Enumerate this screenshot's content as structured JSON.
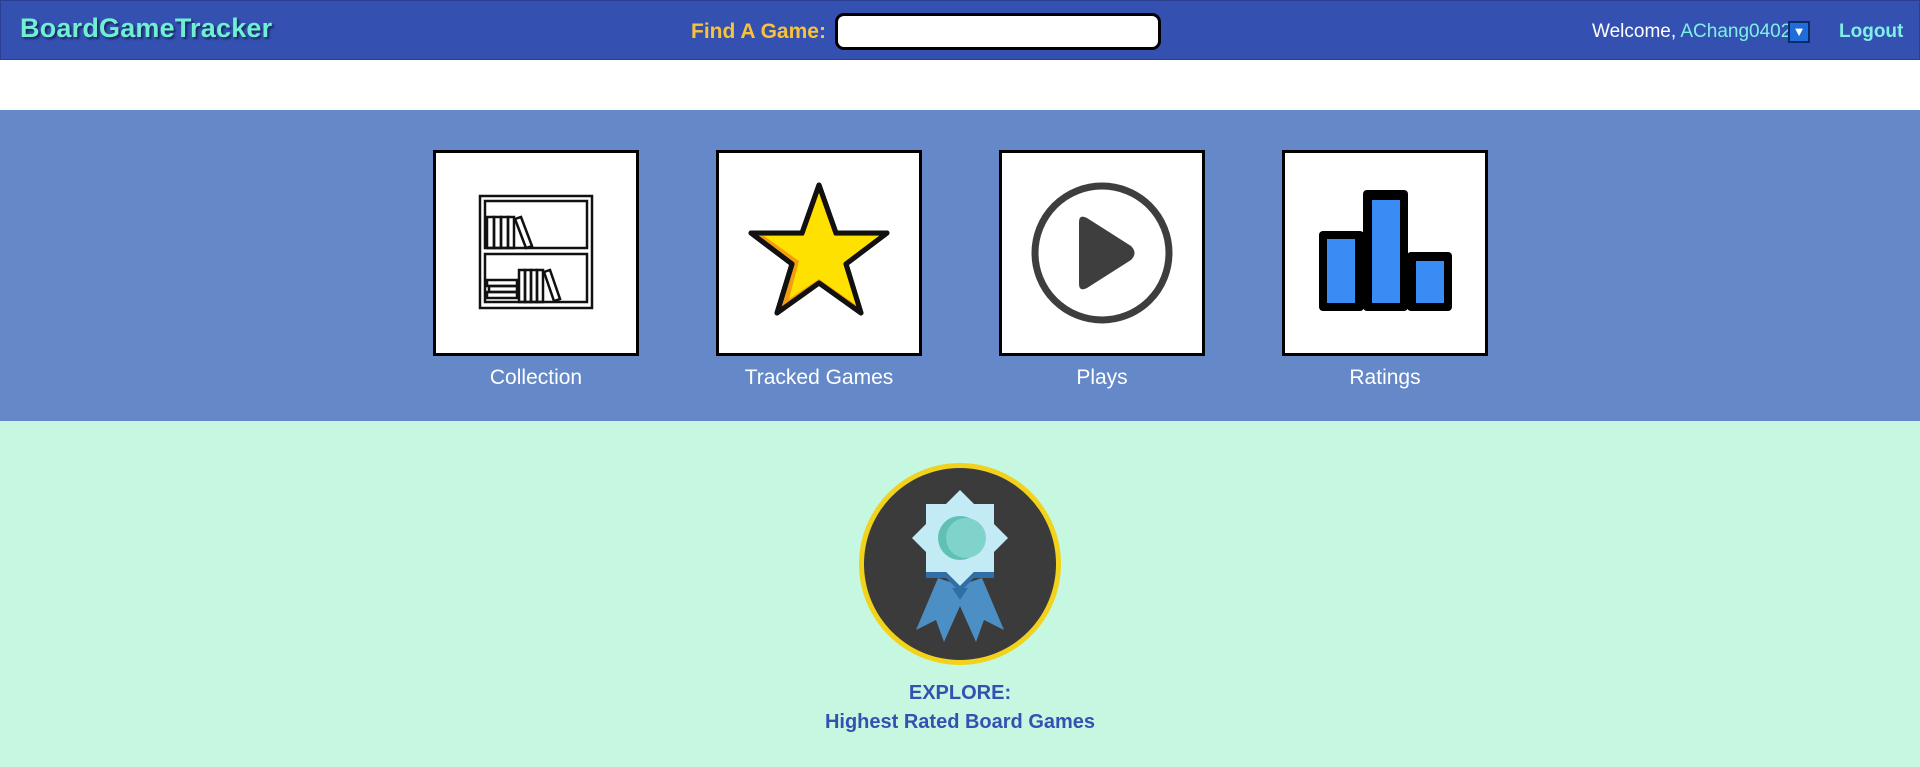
{
  "header": {
    "brand": "BoardGameTracker",
    "find_label": "Find A Game:",
    "search_value": "",
    "welcome_prefix": "Welcome, ",
    "username": "AChang0402",
    "dropdown_glyph": "▼",
    "logout_label": "Logout"
  },
  "tiles": [
    {
      "label": "Collection",
      "icon": "bookshelf-icon"
    },
    {
      "label": "Tracked Games",
      "icon": "star-icon"
    },
    {
      "label": "Plays",
      "icon": "play-icon"
    },
    {
      "label": "Ratings",
      "icon": "bar-chart-icon"
    }
  ],
  "explore": {
    "line1": "EXPLORE:",
    "line2": "Highest Rated Board Games",
    "icon": "award-medal-icon"
  },
  "colors": {
    "topbar": "#3451b2",
    "brand": "#6ff0d2",
    "find_label": "#f8c23a",
    "tiles_band": "#6588c8",
    "explore_bg": "#c6f7e1",
    "explore_text": "#3451b2"
  }
}
